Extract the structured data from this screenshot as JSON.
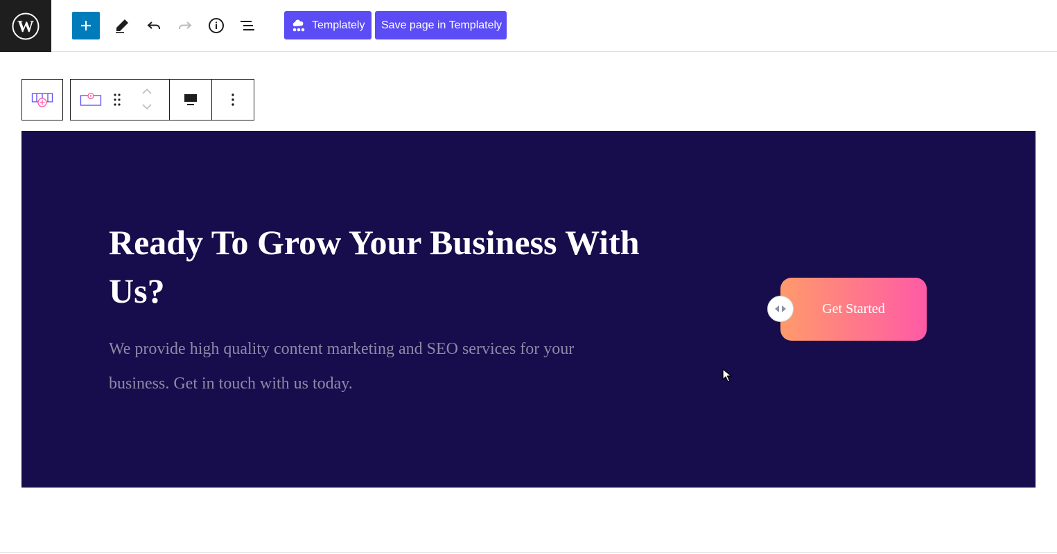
{
  "header": {
    "templately_label": "Templately",
    "save_label": "Save page in Templately"
  },
  "banner": {
    "heading": "Ready To Grow Your Business With Us?",
    "description": "We provide high quality content marketing and SEO services for your business. Get in touch with us today.",
    "cta_label": "Get Started"
  },
  "colors": {
    "banner_bg": "#170c4c",
    "accent_blue": "#007cba",
    "templately_purple": "#5b4cf5",
    "cta_gradient_start": "#ff9a6b",
    "cta_gradient_end": "#ff5aa6"
  }
}
